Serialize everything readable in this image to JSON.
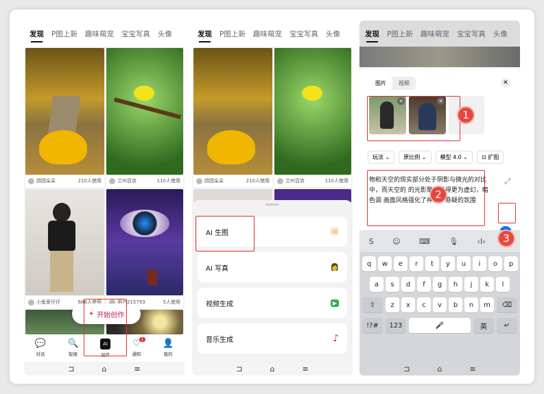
{
  "tabs": [
    "发现",
    "P图上新",
    "趣味萌宠",
    "宝宝写真",
    "头像"
  ],
  "feed": [
    {
      "user": "团团朵朵",
      "uses": "210人使用"
    },
    {
      "user": "兰州百京",
      "uses": "110人使用"
    },
    {
      "user": "小鱼爱仔仔",
      "uses": "686人使用"
    },
    {
      "user": "用户215793",
      "uses": "5人使用"
    }
  ],
  "start_button": "开始创作",
  "nav": [
    {
      "label": "对话",
      "icon": "💬"
    },
    {
      "label": "智搜",
      "icon": "🔍"
    },
    {
      "label": "创作",
      "icon": "AI"
    },
    {
      "label": "通知",
      "icon": "♡"
    },
    {
      "label": "我的",
      "icon": "👤"
    }
  ],
  "notify_badge": "1",
  "sheet": [
    {
      "label": "AI 生图",
      "icon": "🖼"
    },
    {
      "label": "AI 写真",
      "icon": "👩"
    },
    {
      "label": "视频生成",
      "icon": "▶"
    },
    {
      "label": "音乐生成",
      "icon": "♪"
    }
  ],
  "panel": {
    "tab_image": "图片",
    "tab_video": "视频",
    "chips": [
      "玩法",
      "原比例",
      "模型 4.0",
      "扩图"
    ],
    "prompt": "物和天空的现实部分处于阴影与微光的对比中，而天空的  的光影聚焦显得更为虚幻，暗色调  画面风格强化了神秘、悬疑的氛围",
    "send_icon": "↑"
  },
  "steps": [
    "1",
    "2",
    "3"
  ],
  "keyboard": {
    "row1": [
      "q",
      "w",
      "e",
      "r",
      "t",
      "y",
      "u",
      "i",
      "o",
      "p"
    ],
    "row2": [
      "a",
      "s",
      "d",
      "f",
      "g",
      "h",
      "j",
      "k",
      "l"
    ],
    "row3": [
      "z",
      "x",
      "c",
      "v",
      "b",
      "n",
      "m"
    ],
    "shift": "⇧",
    "del": "⌫",
    "sym": "!?#",
    "num": "123",
    "space": "🎤",
    "lang": "英",
    "enter": "↵",
    "toolbar": [
      "S",
      "☺",
      "⌨",
      "🎙",
      "‹I›",
      "⌄"
    ]
  },
  "sys": [
    "⊐",
    "⌂",
    "≡"
  ]
}
